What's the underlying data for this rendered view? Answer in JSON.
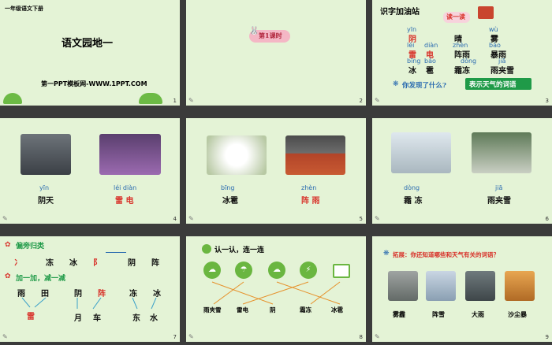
{
  "slides": [
    {
      "num": "1",
      "header": "一年级语文下册",
      "title": "语文园地一",
      "site": "第一PPT模板网-WWW.1PPT.COM"
    },
    {
      "num": "2",
      "badge": "第1课时"
    },
    {
      "num": "3",
      "title": "识字加油站",
      "read_label": "读一读",
      "row1_py": [
        "yīn",
        "wù"
      ],
      "row1": [
        "阴",
        "晴",
        "雾"
      ],
      "row2_py": [
        "léi",
        "diàn",
        "zhèn",
        "bào"
      ],
      "row2": [
        "雷",
        "电",
        "阵雨",
        "暴雨"
      ],
      "row3_py": [
        "bīng",
        "báo",
        "dòng",
        "jiā"
      ],
      "row3": [
        "冰",
        "雹",
        "霜冻",
        "雨夹雪"
      ],
      "question": "你发现了什么?",
      "answer": "表示天气的词语"
    },
    {
      "num": "4",
      "words": [
        {
          "py": "yīn",
          "cn": "阴天"
        },
        {
          "py": "léi diàn",
          "cn": "雷  电"
        }
      ]
    },
    {
      "num": "5",
      "words": [
        {
          "py": "bīng",
          "cn": "冰雹"
        },
        {
          "py": "zhèn",
          "cn": "阵  雨"
        }
      ]
    },
    {
      "num": "6",
      "words": [
        {
          "py": "dòng",
          "cn": "霜  冻"
        },
        {
          "py": "jiā",
          "cn": "雨夹雪"
        }
      ]
    },
    {
      "num": "7",
      "h1": "偏旁归类",
      "row1": [
        "冫",
        "冻",
        "冰",
        "阝",
        "阴",
        "阵"
      ],
      "h2": "加一加，减一减",
      "row2": [
        "雨",
        "田",
        "阴",
        "阵",
        "冻",
        "冰"
      ],
      "row3": [
        "雷",
        "月",
        "车",
        "东",
        "水"
      ]
    },
    {
      "num": "8",
      "title": "认一认，连一连",
      "labels": [
        "雨夹雪",
        "雷电",
        "阴",
        "霜冻",
        "冰雹"
      ]
    },
    {
      "num": "9",
      "title": "拓展：你还知道哪些和天气有关的词语？",
      "labels": [
        "雾霾",
        "阵雪",
        "大雨",
        "沙尘暴"
      ]
    }
  ],
  "colors": {
    "bg": "#e4f3d6",
    "accent_red": "#d8322a",
    "accent_green": "#1f9a48",
    "pinyin": "#2a6bb0"
  }
}
